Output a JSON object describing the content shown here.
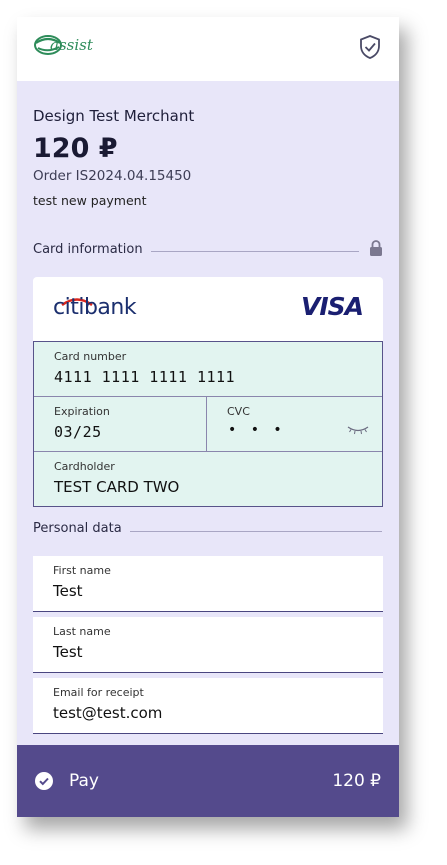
{
  "header": {
    "logo_text": "assist",
    "shield_icon": "shield-check-icon"
  },
  "merchant": {
    "name": "Design Test Merchant",
    "amount": "120 ₽",
    "order": "Order IS2024.04.15450",
    "description": "test new payment"
  },
  "card_section": {
    "label": "Card information",
    "lock_icon": "lock-icon",
    "bank": "citibank",
    "brand": "VISA",
    "card_number_label": "Card number",
    "card_number_value": "4111 1111 1111 1111",
    "expiration_label": "Expiration",
    "expiration_value": "03/25",
    "cvc_label": "CVC",
    "cvc_value": "• • •",
    "cardholder_label": "Cardholder",
    "cardholder_value": "TEST CARD TWO"
  },
  "personal_section": {
    "label": "Personal data",
    "first_name_label": "First name",
    "first_name_value": "Test",
    "last_name_label": "Last name",
    "last_name_value": "Test",
    "email_label": "Email for receipt",
    "email_value": "test@test.com"
  },
  "pay": {
    "label": "Pay",
    "amount": "120 ₽"
  },
  "colors": {
    "background": "#e8e6f9",
    "card_fields": "#e2f4f0",
    "pay_bar": "#544a8c",
    "brand_green": "#2e8c5a",
    "visa_blue": "#1a1f71"
  }
}
